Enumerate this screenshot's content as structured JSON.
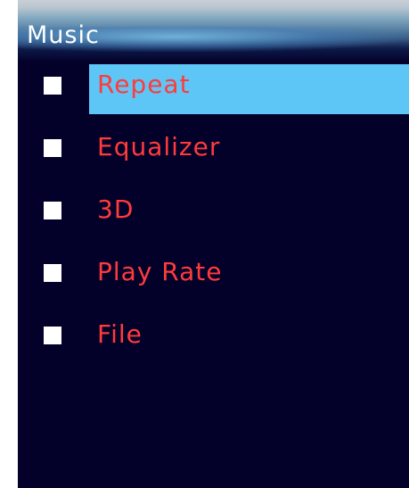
{
  "header": {
    "title": "Music"
  },
  "menu": {
    "items": [
      {
        "label": "Repeat",
        "selected": true
      },
      {
        "label": "Equalizer",
        "selected": false
      },
      {
        "label": "3D",
        "selected": false
      },
      {
        "label": "Play Rate",
        "selected": false
      },
      {
        "label": "File",
        "selected": false
      }
    ]
  },
  "colors": {
    "background": "#03002a",
    "item_text": "#ff3b3b",
    "selection": "#5ec5f7",
    "bullet": "#ffffff",
    "title_text": "#ffffff"
  }
}
